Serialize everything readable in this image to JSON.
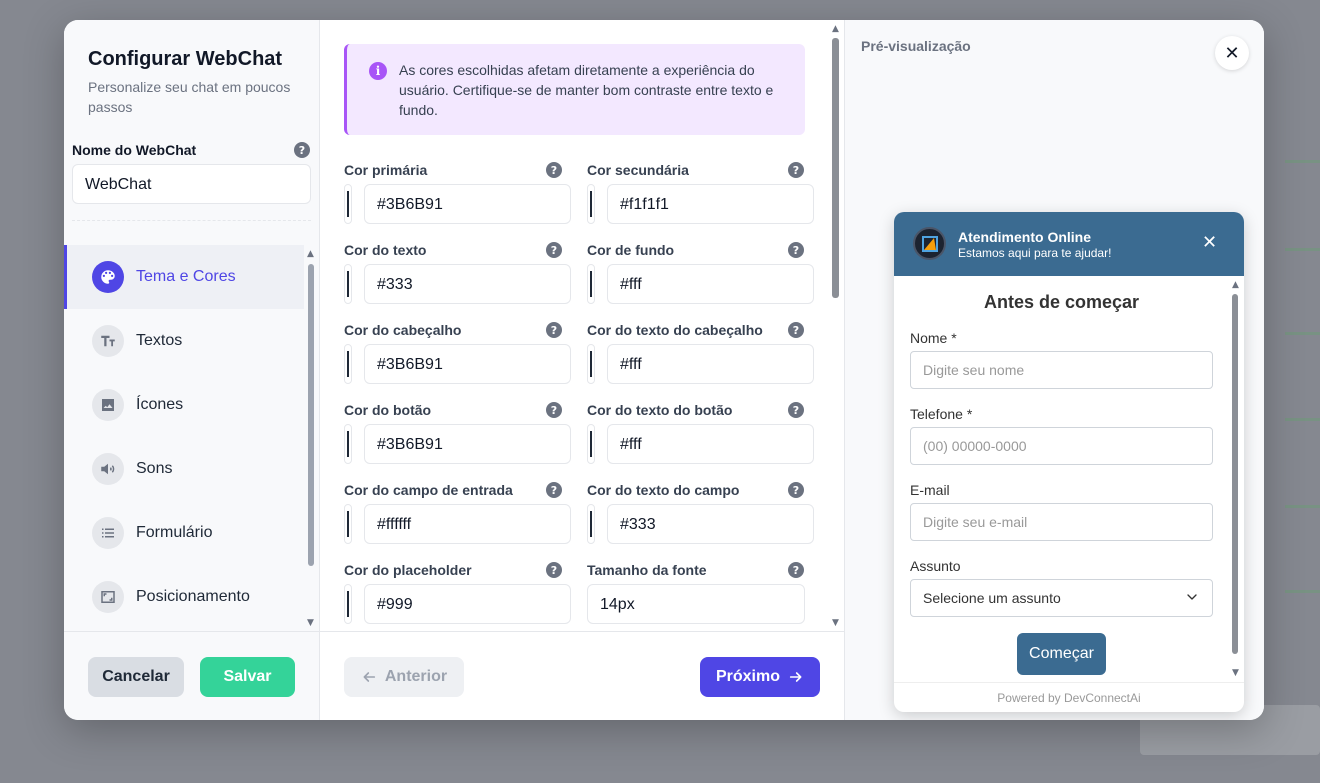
{
  "modal": {
    "title": "Configurar WebChat",
    "subtitle": "Personalize seu chat em poucos passos",
    "name_label": "Nome do WebChat",
    "name_value": "WebChat",
    "nav": [
      {
        "label": "Tema e Cores",
        "icon": "palette-icon",
        "active": true
      },
      {
        "label": "Textos",
        "icon": "text-icon",
        "active": false
      },
      {
        "label": "Ícones",
        "icon": "image-icon",
        "active": false
      },
      {
        "label": "Sons",
        "icon": "volume-icon",
        "active": false
      },
      {
        "label": "Formulário",
        "icon": "list-icon",
        "active": false
      },
      {
        "label": "Posicionamento",
        "icon": "position-icon",
        "active": false
      }
    ],
    "cancel_label": "Cancelar",
    "save_label": "Salvar"
  },
  "theme": {
    "info_text": "As cores escolhidas afetam diretamente a experiência do usuário. Certifique-se de manter bom contraste entre texto e fundo.",
    "fields": [
      {
        "label": "Cor primária",
        "value": "#3B6B91",
        "swatch": true
      },
      {
        "label": "Cor secundária",
        "value": "#f1f1f1",
        "swatch": true
      },
      {
        "label": "Cor do texto",
        "value": "#333",
        "swatch": true
      },
      {
        "label": "Cor de fundo",
        "value": "#fff",
        "swatch": true
      },
      {
        "label": "Cor do cabeçalho",
        "value": "#3B6B91",
        "swatch": true
      },
      {
        "label": "Cor do texto do cabeçalho",
        "value": "#fff",
        "swatch": true
      },
      {
        "label": "Cor do botão",
        "value": "#3B6B91",
        "swatch": true
      },
      {
        "label": "Cor do texto do botão",
        "value": "#fff",
        "swatch": true
      },
      {
        "label": "Cor do campo de entrada",
        "value": "#ffffff",
        "swatch": true
      },
      {
        "label": "Cor do texto do campo",
        "value": "#333",
        "swatch": true
      },
      {
        "label": "Cor do placeholder",
        "value": "#999",
        "swatch": true
      },
      {
        "label": "Tamanho da fonte",
        "value": "14px",
        "swatch": false
      }
    ],
    "prev_label": "Anterior",
    "next_label": "Próximo"
  },
  "preview": {
    "label": "Pré-visualização",
    "chat": {
      "title": "Atendimento Online",
      "subtitle": "Estamos aqui para te ajudar!",
      "heading": "Antes de começar",
      "fields": [
        {
          "label": "Nome *",
          "placeholder": "Digite seu nome"
        },
        {
          "label": "Telefone *",
          "placeholder": "(00) 00000-0000"
        },
        {
          "label": "E-mail",
          "placeholder": "Digite seu e-mail"
        }
      ],
      "subject_label": "Assunto",
      "subject_value": "Selecione um assunto",
      "start_label": "Começar",
      "powered_by": "Powered by DevConnectAi"
    }
  },
  "colors": {
    "accent": "#4f46e5",
    "save": "#34d399",
    "chat_primary": "#3B6B91",
    "info_border": "#a855f7"
  }
}
